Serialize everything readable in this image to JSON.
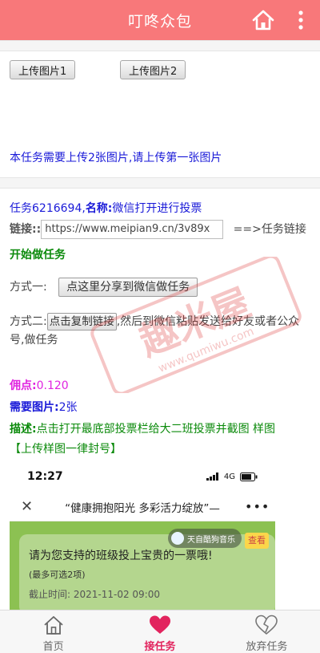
{
  "header": {
    "title": "叮咚众包",
    "home_icon": "home-icon",
    "more_icon": "more-vertical-icon"
  },
  "upload": {
    "button1": "上传图片1",
    "button2": "上传图片2",
    "hint": "本任务需要上传2张图片,请上传第一张图片"
  },
  "task": {
    "id_prefix": "任务",
    "id": "6216694",
    "name_label": "名称:",
    "name": "微信打开进行投票",
    "link_label": "链接::",
    "link_value": "https://www.meipian9.cn/3v89x",
    "link_suffix": "==>任务链接",
    "start": "开始做任务",
    "method1_label": "方式一:",
    "method1_button": "点这里分享到微信做任务",
    "method2_label": "方式二:",
    "method2_button": "点击复制链接",
    "method2_text": ",然后到微信粘贴发送给好友或者公众号,做任务",
    "commission_label": "佣点:",
    "commission": "0.120",
    "images_label": "需要图片:",
    "images": "2张",
    "desc_label": "描述:",
    "desc": "点击打开最底部投票栏给大二班投票并截图 样图",
    "desc_note": "【上传样图一律封号】"
  },
  "sample": {
    "time": "12:27",
    "network": "4G",
    "title": "“健康拥抱阳光 多彩活力绽放”—",
    "close_icon": "close-icon",
    "menu_icon": "more-horizontal-icon",
    "music": "天自酷狗音乐",
    "view": "查看",
    "prompt": "请为您支持的班级投上宝贵的一票哦!",
    "limit": "(最多可选2项)",
    "deadline": "截止时间:  2021-11-02 09:00"
  },
  "watermark": {
    "main": "趣米屋",
    "url": "www.qumiwu.com"
  },
  "tabs": [
    {
      "label": "首页",
      "icon": "home-icon"
    },
    {
      "label": "接任务",
      "icon": "heart-icon"
    },
    {
      "label": "放弃任务",
      "icon": "broken-heart-icon"
    }
  ],
  "colors": {
    "header": "#f8787a",
    "link_blue": "#1a1ad8",
    "green": "#0b8a0b",
    "pink": "#e024e0",
    "active_tab": "#e2245e"
  }
}
